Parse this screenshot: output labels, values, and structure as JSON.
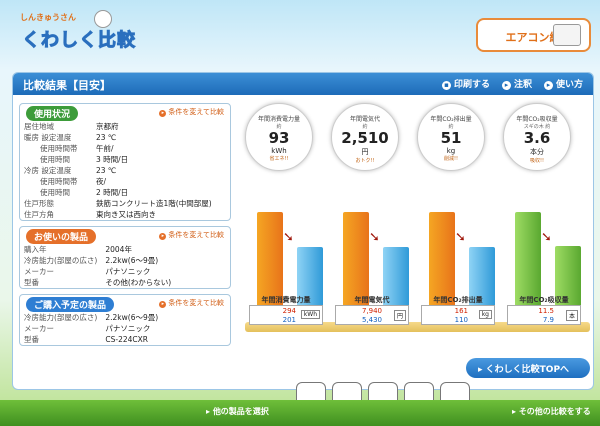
{
  "logo": {
    "small": "しんきゅうさん",
    "main": "くわしく比較"
  },
  "aircon_button": {
    "label": "エアコン編"
  },
  "panel": {
    "title": "比較結果【目安】",
    "links": [
      {
        "label": "印刷する"
      },
      {
        "label": "注釈"
      },
      {
        "label": "使い方"
      }
    ]
  },
  "usage": {
    "title": "使用状況",
    "change": "条件を変えて比較",
    "rows": [
      {
        "k": "居住地域",
        "v": "京都府"
      },
      {
        "k": "暖房 設定温度",
        "v": "23 ℃"
      },
      {
        "k": "使用時間帯",
        "v": "午前/"
      },
      {
        "k": "使用時間",
        "v": "3 時間/日"
      },
      {
        "k": "冷房 設定温度",
        "v": "23 ℃"
      },
      {
        "k": "使用時間帯",
        "v": "夜/"
      },
      {
        "k": "使用時間",
        "v": "2 時間/日"
      },
      {
        "k": "住戸形態",
        "v": "鉄筋コンクリート造1階(中間部屋)"
      },
      {
        "k": "住戸方角",
        "v": "東向き又は西向き"
      }
    ]
  },
  "current": {
    "title": "お使いの製品",
    "change": "条件を変えて比較",
    "rows": [
      {
        "k": "購入年",
        "v": "2004年"
      },
      {
        "k": "冷房能力(部屋の広さ)",
        "v": "2.2kw(6〜9畳)"
      },
      {
        "k": "メーカー",
        "v": "パナソニック"
      },
      {
        "k": "型番",
        "v": "その他(わからない)"
      }
    ]
  },
  "planned": {
    "title": "ご購入予定の製品",
    "change": "条件を変えて比較",
    "rows": [
      {
        "k": "冷房能力(部屋の広さ)",
        "v": "2.2kw(6〜9畳)"
      },
      {
        "k": "メーカー",
        "v": "パナソニック"
      },
      {
        "k": "型番",
        "v": "CS-224CXR"
      }
    ]
  },
  "circles": [
    {
      "title": "年間消費電力量",
      "sub": "約",
      "value": "93",
      "unit": "kWh",
      "note": "省エネ!!"
    },
    {
      "title": "年間電気代",
      "sub": "約",
      "value": "2,510",
      "unit": "円",
      "note": "おトク!!"
    },
    {
      "title": "年間CO₂排出量",
      "sub": "約",
      "value": "51",
      "unit": "kg",
      "note": "削減!!"
    },
    {
      "title": "年間CO₂吸収量",
      "sub": "スギの木 約",
      "value": "3.6",
      "unit": "本分",
      "note": "吸収!!"
    }
  ],
  "chart_data": {
    "type": "bar",
    "categories": [
      "年間消費電力量",
      "年間電気代",
      "年間CO₂排出量",
      "年間CO₂吸収量"
    ],
    "series": [
      {
        "values": [
          294,
          7940,
          161,
          11.5
        ]
      },
      {
        "values": [
          201,
          5430,
          110,
          7.9
        ]
      }
    ],
    "units": [
      "kWh",
      "円",
      "kg",
      "本"
    ]
  },
  "values": [
    {
      "a": "294",
      "b": "201",
      "u": "kWh"
    },
    {
      "a": "7,940",
      "b": "5,430",
      "u": "円"
    },
    {
      "a": "161",
      "b": "110",
      "u": "kg"
    },
    {
      "a": "11.5",
      "b": "7.9",
      "u": "本"
    }
  ],
  "top_button": {
    "label": "くわしく比較TOPへ"
  },
  "bottom": {
    "left": "他の製品を選択",
    "right": "その他の比較をする"
  },
  "colors": {
    "accent": "#1d6bb8",
    "orange": "#e8731a",
    "blue": "#2f9ad8",
    "green": "#5aa830"
  }
}
